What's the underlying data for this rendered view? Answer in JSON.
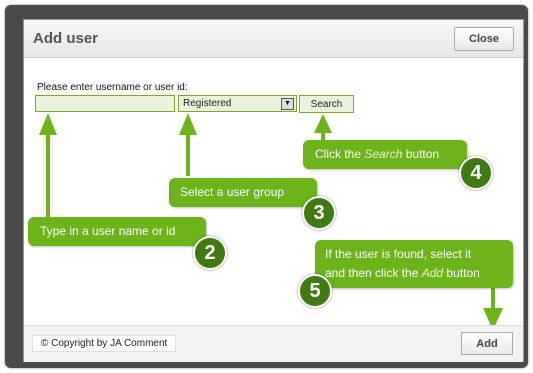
{
  "dialog": {
    "title": "Add user",
    "close_label": "Close"
  },
  "form": {
    "prompt": "Please enter username or user id:",
    "username_value": "",
    "group_selected": "Registered",
    "search_label": "Search"
  },
  "callouts": {
    "c2": {
      "text": "Type in a user name or id",
      "number": "2"
    },
    "c3": {
      "text": "Select a user group",
      "number": "3"
    },
    "c4": {
      "before": "Click the ",
      "emph": "Search",
      "after": " button",
      "number": "4"
    },
    "c5": {
      "line1": "If the user is found, select it",
      "before": "and then click the ",
      "emph": "Add",
      "after": " button",
      "number": "5"
    }
  },
  "footer": {
    "copyright": "© Copyright by JA Comment",
    "add_label": "Add"
  },
  "colors": {
    "accent_green": "#6db31c",
    "badge_green": "#3f7b12",
    "frame": "#4a4a4a"
  }
}
